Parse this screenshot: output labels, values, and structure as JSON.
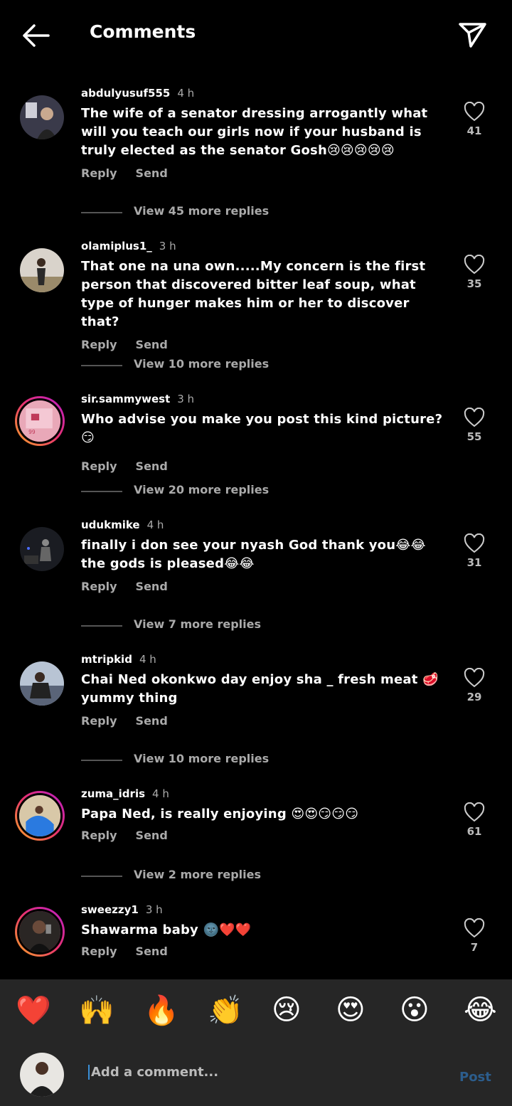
{
  "header": {
    "title": "Comments"
  },
  "comments": [
    {
      "user": "abdulyusuf555",
      "time": "4 h",
      "text": "The wife of a senator dressing arrogantly what will you teach our girls now if your husband is truly elected as the senator Gosh😢😢😢😢😢",
      "likes": "41",
      "reply": "Reply",
      "send": "Send",
      "view": "View 45 more replies"
    },
    {
      "user": "olamiplus1_",
      "time": "3 h",
      "text": "That one na una own.....My concern is the first person that discovered bitter leaf soup, what type of hunger makes him or her to discover that?",
      "likes": "35",
      "reply": "Reply",
      "send": "Send",
      "view": "View 10 more replies"
    },
    {
      "user": "sir.sammywest",
      "time": "3 h",
      "text": "Who advise you make you post this kind picture? 😏",
      "likes": "55",
      "reply": "Reply",
      "send": "Send",
      "view": "View 20 more replies"
    },
    {
      "user": "udukmike",
      "time": "4 h",
      "text": "finally i don see your nyash God thank you😂😂the gods is pleased😂😂",
      "likes": "31",
      "reply": "Reply",
      "send": "Send",
      "view": "View 7 more replies"
    },
    {
      "user": "mtripkid",
      "time": "4 h",
      "text": "Chai Ned okonkwo day enjoy sha _   fresh meat 🥩 yummy thing",
      "likes": "29",
      "reply": "Reply",
      "send": "Send",
      "view": "View 10 more replies"
    },
    {
      "user": "zuma_idris",
      "time": "4 h",
      "text": "Papa Ned, is really enjoying 😍😍😏😏😏",
      "likes": "61",
      "reply": "Reply",
      "send": "Send",
      "view": "View 2 more replies"
    },
    {
      "user": "sweezzy1",
      "time": "3 h",
      "text": "Shawarma baby 🌚❤️❤️",
      "likes": "7",
      "reply": "Reply",
      "send": "Send"
    }
  ],
  "reactions": [
    "❤️",
    "🙌",
    "🔥",
    "👏",
    "😢",
    "😍",
    "😮",
    "😂"
  ],
  "composer": {
    "placeholder": "Add a comment...",
    "post_label": "Post"
  },
  "colors": {
    "background": "#000000",
    "bar": "#262626",
    "post": "#2c5d8c",
    "ring": "#e8336d"
  },
  "icons": [
    "back-arrow-icon",
    "send-direct-icon",
    "heart-outline-icon"
  ]
}
